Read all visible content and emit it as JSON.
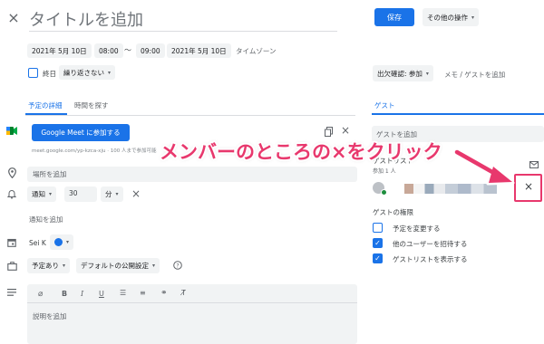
{
  "header": {
    "close_icon": "×",
    "title_placeholder": "タイトルを追加",
    "save_label": "保存",
    "more_actions_label": "その他の操作"
  },
  "datetime": {
    "start_date": "2021年 5月 10日",
    "start_time": "08:00",
    "separator": "〜",
    "end_time": "09:00",
    "end_date": "2021年 5月 10日",
    "timezone_label": "タイムゾーン",
    "all_day_label": "終日",
    "repeat_label": "繰り返さない"
  },
  "rsvp": {
    "label": "出欠確認: 参加",
    "notes_label": "メモ / ゲストを追加"
  },
  "tabs": [
    {
      "label": "予定の詳細"
    },
    {
      "label": "時間を探す"
    }
  ],
  "meet": {
    "button_label": "Google Meet に参加する",
    "link_text": "meet.google.com/yp-kzca-xju · 100 人まで参加可能"
  },
  "location_placeholder": "場所を追加",
  "notification": {
    "type": "通知",
    "value": "30",
    "unit": "分",
    "add_label": "通知を追加"
  },
  "calendar": {
    "owner": "Sei K",
    "color": "#1a73e8"
  },
  "visibility": {
    "status": "予定あり",
    "default_visibility": "デフォルトの公開設定"
  },
  "description_placeholder": "説明を追加",
  "guests": {
    "tab_label": "ゲスト",
    "add_placeholder": "ゲストを追加",
    "list_label": "ゲストリスト",
    "attending_count": "参加 1 人",
    "permissions_title": "ゲストの権限",
    "permissions": [
      {
        "label": "予定を変更する",
        "checked": false
      },
      {
        "label": "他のユーザーを招待する",
        "checked": true
      },
      {
        "label": "ゲストリストを表示する",
        "checked": true
      }
    ]
  },
  "annotation": {
    "text": "メンバーのところの×をクリック",
    "color": "#e8386d"
  }
}
